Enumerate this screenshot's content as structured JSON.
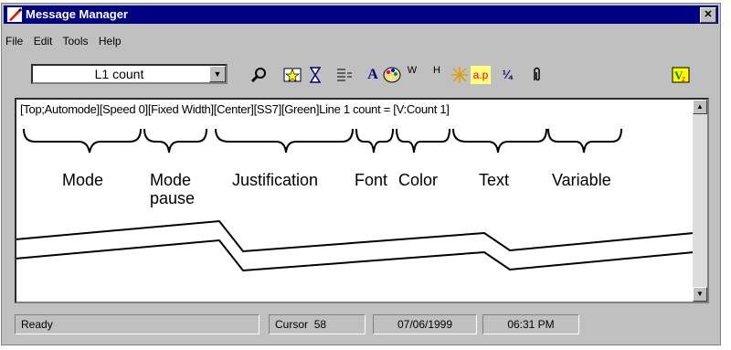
{
  "window": {
    "title": "Message Manager",
    "close_symbol": "✕"
  },
  "menu": [
    "File",
    "Edit",
    "Tools",
    "Help"
  ],
  "toolbar": {
    "combo_value": "L1 count",
    "combo_arrow": "▼",
    "font_glyph": "A",
    "font_color_glyph": "a.p",
    "wrap_w": "W",
    "wrap_h": "H",
    "fraction_glyph": "¼"
  },
  "editor": {
    "text": "[Top;Automode][Speed 0][Fixed Width][Center][SS7][Green]Line 1 count = [V:Count 1]"
  },
  "annotations": {
    "mode": "Mode",
    "mode_pause_1": "Mode",
    "mode_pause_2": "pause",
    "justification": "Justification",
    "font": "Font",
    "color": "Color",
    "text": "Text",
    "variable": "Variable"
  },
  "status": {
    "ready": "Ready",
    "cursor_label": "Cursor",
    "cursor_value": "58",
    "date": "07/06/1999",
    "time": "06:31 PM"
  },
  "colors": {
    "title_bar": "#000080",
    "window_bg": "#c0c0c0"
  }
}
